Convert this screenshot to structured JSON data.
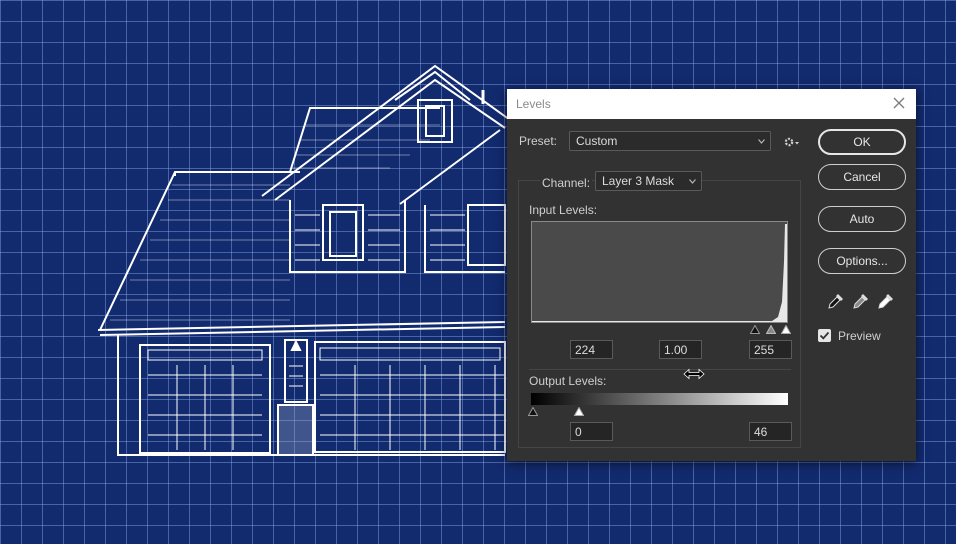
{
  "dialog": {
    "title": "Levels",
    "preset_label": "Preset:",
    "preset_value": "Custom",
    "channel_label": "Channel:",
    "channel_value": "Layer 3 Mask",
    "input_levels_label": "Input Levels:",
    "input_black": "224",
    "input_gamma": "1.00",
    "input_white": "255",
    "output_levels_label": "Output Levels:",
    "output_black": "0",
    "output_white": "46",
    "buttons": {
      "ok": "OK",
      "cancel": "Cancel",
      "auto": "Auto",
      "options": "Options..."
    },
    "preview_label": "Preview",
    "preview_checked": true
  },
  "colors": {
    "background": "#122a6e",
    "grid": "#8caae6",
    "dialog": "#323232",
    "linework": "#ffffff"
  },
  "icons": [
    "close-icon",
    "chevron-down-icon",
    "gear-icon",
    "black-eyedropper-icon",
    "gray-eyedropper-icon",
    "white-eyedropper-icon",
    "resize-cursor-icon",
    "checkmark-icon"
  ]
}
